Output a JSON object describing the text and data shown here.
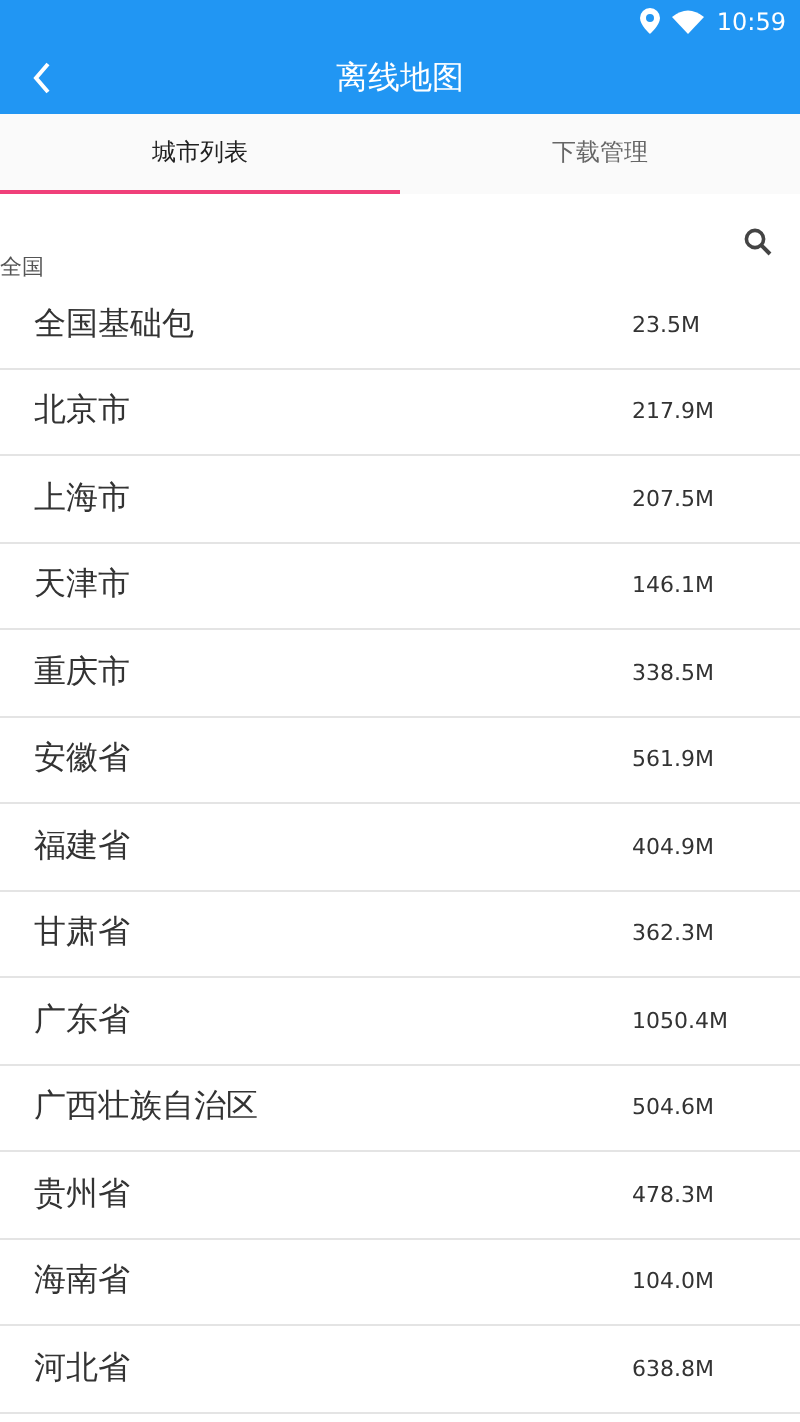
{
  "status_bar": {
    "time": "10:59"
  },
  "app_bar": {
    "title": "离线地图"
  },
  "tabs": [
    {
      "label": "城市列表",
      "selected": true
    },
    {
      "label": "下载管理",
      "selected": false
    }
  ],
  "section": {
    "title": "全国"
  },
  "cities": [
    {
      "name": "全国基础包",
      "size": "23.5M"
    },
    {
      "name": "北京市",
      "size": "217.9M"
    },
    {
      "name": "上海市",
      "size": "207.5M"
    },
    {
      "name": "天津市",
      "size": "146.1M"
    },
    {
      "name": "重庆市",
      "size": "338.5M"
    },
    {
      "name": "安徽省",
      "size": "561.9M"
    },
    {
      "name": "福建省",
      "size": "404.9M"
    },
    {
      "name": "甘肃省",
      "size": "362.3M"
    },
    {
      "name": "广东省",
      "size": "1050.4M"
    },
    {
      "name": "广西壮族自治区",
      "size": "504.6M"
    },
    {
      "name": "贵州省",
      "size": "478.3M"
    },
    {
      "name": "海南省",
      "size": "104.0M"
    },
    {
      "name": "河北省",
      "size": "638.8M"
    }
  ]
}
